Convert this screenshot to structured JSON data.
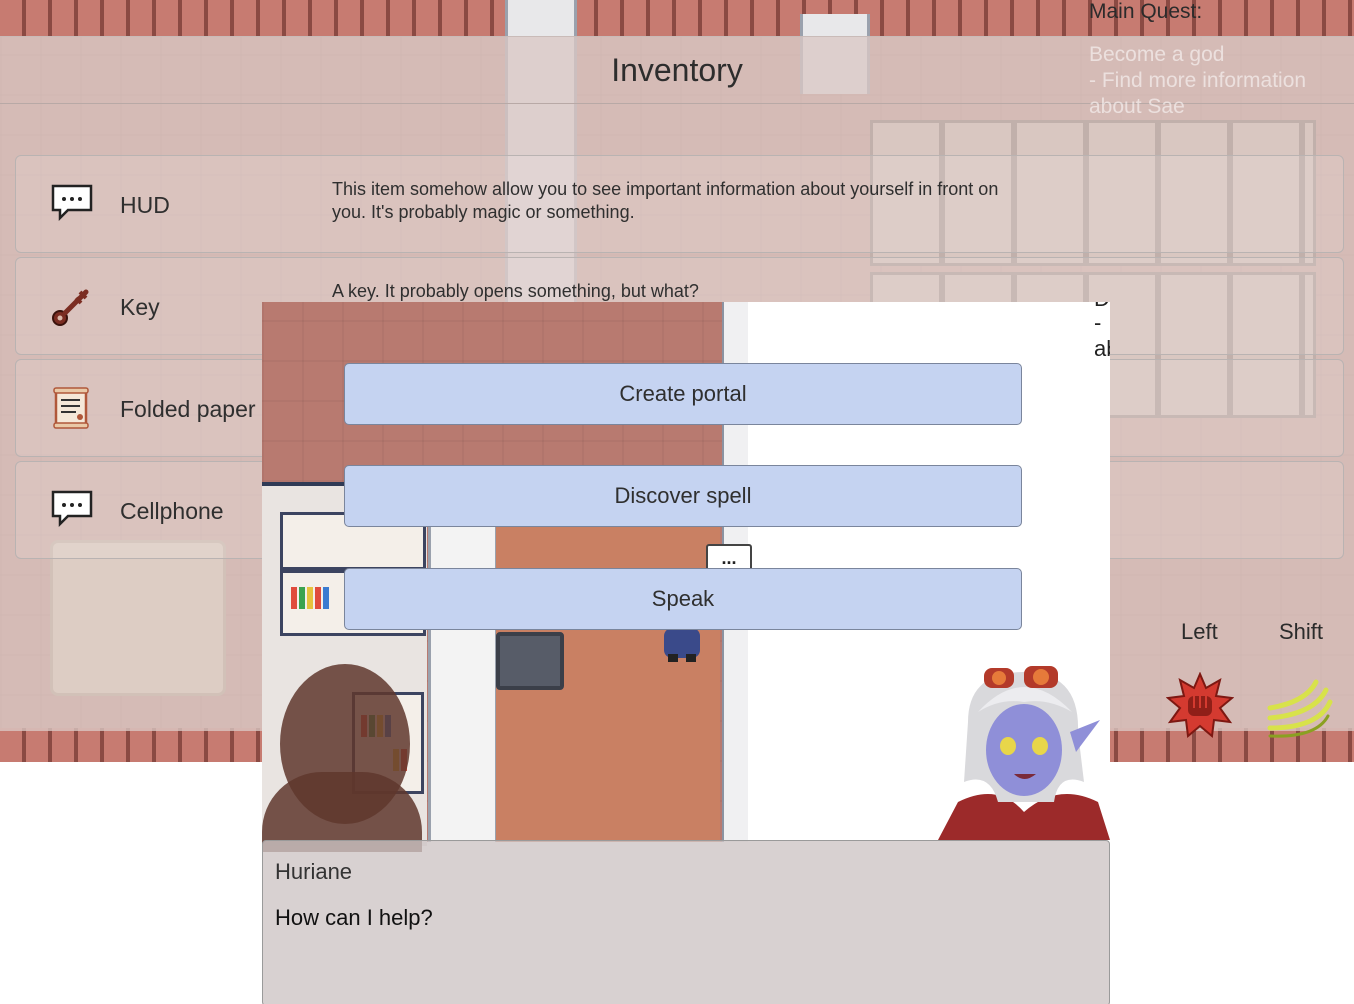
{
  "inventory": {
    "title": "Inventory",
    "items": [
      {
        "name": "HUD",
        "icon": "speech-bubble-icon",
        "description": "This item somehow allow you to see important information about yourself in front on you. It's probably magic or something."
      },
      {
        "name": "Key",
        "icon": "key-icon",
        "description": "A key. It probably opens something, but what?"
      },
      {
        "name": "Folded paper",
        "icon": "scroll-icon",
        "description": ""
      },
      {
        "name": "Cellphone",
        "icon": "speech-bubble-icon",
        "description": ""
      }
    ]
  },
  "quest": {
    "title": "Main Quest:",
    "goal": "Become a god",
    "task": " - Find more information about Sae",
    "fragment_lines": [
      "D",
      " -",
      "ab"
    ]
  },
  "hotkeys": [
    {
      "label": "Left",
      "icon": "fist-burst-icon"
    },
    {
      "label": "Shift",
      "icon": "dash-swoosh-icon"
    }
  ],
  "dialog": {
    "choices": [
      "Create portal",
      "Discover spell",
      "Speak"
    ],
    "bubble": "...",
    "speaker": "Huriane",
    "line": "How can I help?"
  },
  "colors": {
    "choice_bg": "#c5d3f1",
    "panel_overlay": "#dac8c4",
    "textbox_bg": "#cdc4c4"
  }
}
